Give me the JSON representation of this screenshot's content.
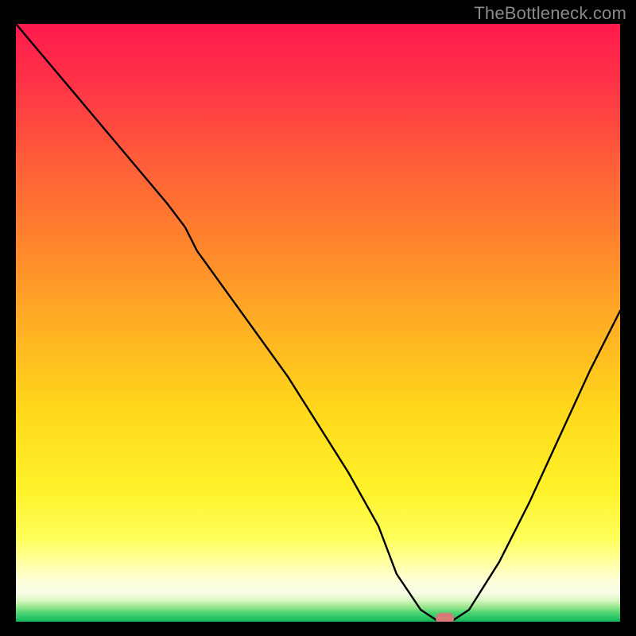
{
  "watermark": "TheBottleneck.com",
  "colors": {
    "marker_fill": "#d97a7a"
  },
  "gradient_stops": [
    {
      "offset": 0.0,
      "color": "#ff1a4d"
    },
    {
      "offset": 0.1,
      "color": "#ff3347"
    },
    {
      "offset": 0.22,
      "color": "#ff5a3a"
    },
    {
      "offset": 0.35,
      "color": "#ff7f2e"
    },
    {
      "offset": 0.5,
      "color": "#ffae24"
    },
    {
      "offset": 0.65,
      "color": "#ffd91a"
    },
    {
      "offset": 0.78,
      "color": "#fff22a"
    },
    {
      "offset": 0.86,
      "color": "#ffff5a"
    },
    {
      "offset": 0.9,
      "color": "#ffffa0"
    },
    {
      "offset": 0.93,
      "color": "#ffffd8"
    },
    {
      "offset": 0.953,
      "color": "#f5fce6"
    },
    {
      "offset": 0.965,
      "color": "#d8f5c0"
    },
    {
      "offset": 0.975,
      "color": "#9be78e"
    },
    {
      "offset": 0.985,
      "color": "#4fd573"
    },
    {
      "offset": 1.0,
      "color": "#0fb85a"
    }
  ],
  "chart_data": {
    "type": "line",
    "title": "",
    "xlabel": "",
    "ylabel": "",
    "xlim": [
      0,
      100
    ],
    "ylim": [
      0,
      100
    ],
    "x": [
      0,
      5,
      10,
      15,
      20,
      25,
      28,
      30,
      35,
      40,
      45,
      50,
      55,
      60,
      63,
      67,
      70,
      72,
      75,
      80,
      85,
      90,
      95,
      100
    ],
    "values": [
      100,
      94,
      88,
      82,
      76,
      70,
      66,
      62,
      55,
      48,
      41,
      33,
      25,
      16,
      8,
      2,
      0,
      0,
      2,
      10,
      20,
      31,
      42,
      52
    ],
    "marker": {
      "x": 71,
      "y": 0.5,
      "width_x": 3.0,
      "height_y": 2.0
    },
    "annotations": []
  }
}
